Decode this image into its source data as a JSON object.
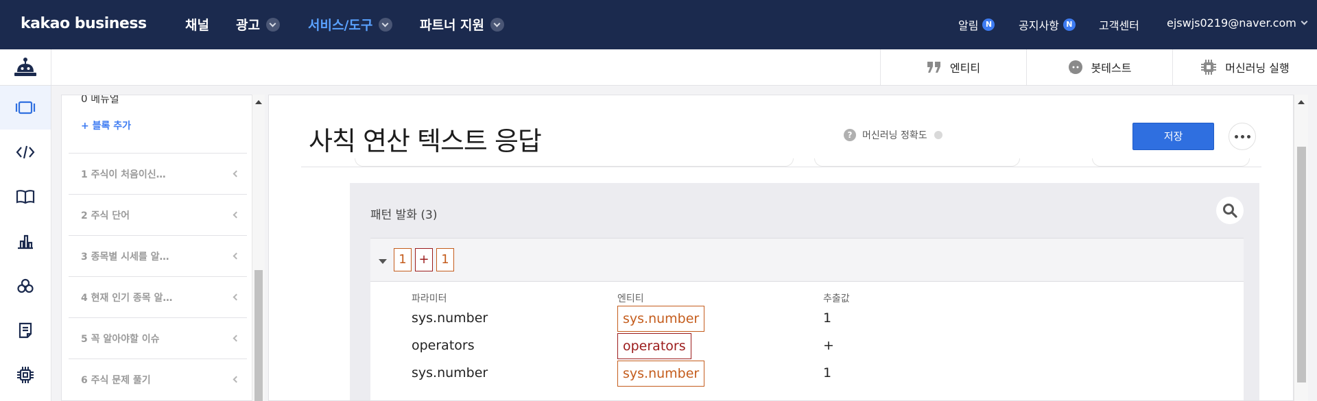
{
  "topnav": {
    "logo": "kakao business",
    "menu": [
      {
        "label": "채널",
        "dropdown": false,
        "active": false
      },
      {
        "label": "광고",
        "dropdown": true,
        "active": false
      },
      {
        "label": "서비스/도구",
        "dropdown": true,
        "active": true
      },
      {
        "label": "파트너 지원",
        "dropdown": true,
        "active": false
      }
    ],
    "alerts_label": "알림",
    "alerts_badge": "N",
    "notice_label": "공지사항",
    "notice_badge": "N",
    "support_label": "고객센터",
    "account": "ejswjs0219@naver.com"
  },
  "toolbar": {
    "entity_label": "엔티티",
    "bottest_label": "봇테스트",
    "ml_run_label": "머신러닝 실행"
  },
  "rail": {
    "icons": [
      "block-icon",
      "code-icon",
      "book-icon",
      "bar-chart-icon",
      "triple-circle-icon",
      "document-icon",
      "chip-icon"
    ]
  },
  "block_panel": {
    "cut_text": "0 메뉴얼",
    "add_block": "+ 블록 추가",
    "items": [
      "1 주식이 처음이신…",
      "2 주식 단어",
      "3 종목별 시세를 알…",
      "4 현재 인기 종목 알…",
      "5 꼭 알아야할 이슈",
      "6 주식 문제 풀기"
    ]
  },
  "editor": {
    "title": "사칙 연산 텍스트 응답",
    "accuracy_label": "머신러닝 정확도",
    "help_glyph": "?",
    "save_label": "저장",
    "pattern_title": "패턴 발화 (3)",
    "tokens": [
      "1",
      "+",
      "1"
    ],
    "param_headers": {
      "param": "파라미터",
      "entity": "엔티티",
      "value": "추출값"
    },
    "params": [
      {
        "param": "sys.number",
        "entity": "sys.number",
        "value": "1"
      },
      {
        "param": "operators",
        "entity": "operators",
        "value": "+"
      },
      {
        "param": "sys.number",
        "entity": "sys.number",
        "value": "1"
      }
    ]
  },
  "colors": {
    "nav_bg": "#1b2a4e",
    "accent": "#2f6fe0",
    "active_menu": "#5aa2ff",
    "entity_orange": "#c45c1c",
    "entity_red": "#9b1b1b"
  }
}
